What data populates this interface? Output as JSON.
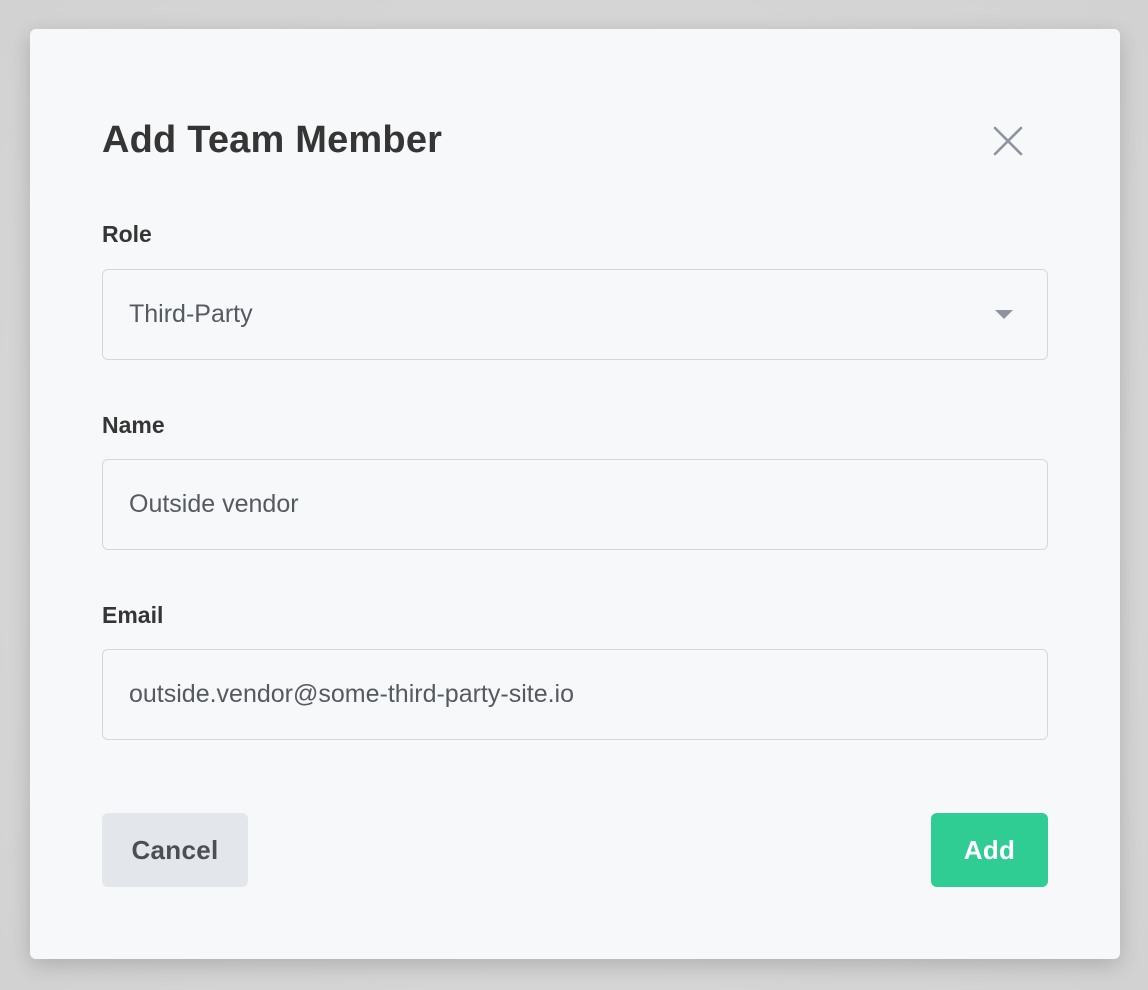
{
  "dialog": {
    "title": "Add Team Member",
    "close_icon": "close-icon"
  },
  "form": {
    "role": {
      "label": "Role",
      "selected": "Third-Party",
      "icon": "chevron-down-icon"
    },
    "name": {
      "label": "Name",
      "value": "Outside vendor"
    },
    "email": {
      "label": "Email",
      "value": "outside.vendor@some-third-party-site.io"
    }
  },
  "actions": {
    "cancel_label": "Cancel",
    "add_label": "Add"
  },
  "colors": {
    "primary": "#2fcc94",
    "secondary_button": "#e3e7eb",
    "modal_background": "#f7f8fa",
    "text": "#353535"
  }
}
